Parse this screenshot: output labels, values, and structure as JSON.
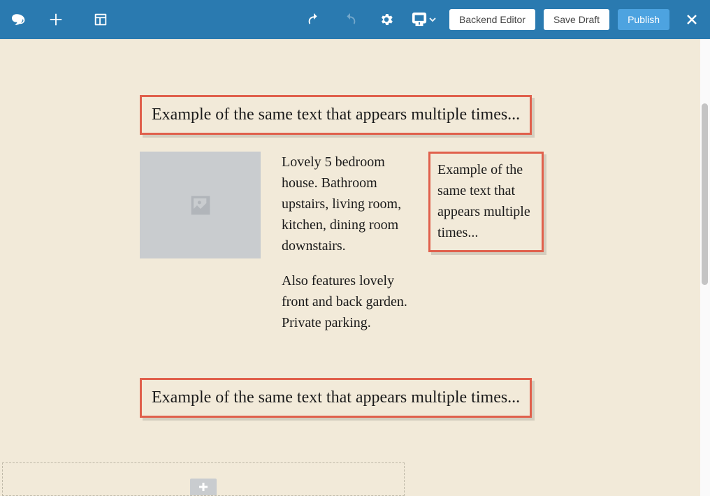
{
  "toolbar": {
    "backend_editor_label": "Backend Editor",
    "save_draft_label": "Save Draft",
    "publish_label": "Publish"
  },
  "content": {
    "heading1": "Example of the same text that appears multiple times...",
    "paragraph1": "Lovely 5 bedroom house. Bathroom upstairs, living room, kitchen, dining room downstairs.",
    "paragraph2": "Also features lovely front and back garden. Private parking.",
    "side_text": "Example of the same text that appears multiple times...",
    "heading2": "Example of the same text that appears multiple times..."
  }
}
